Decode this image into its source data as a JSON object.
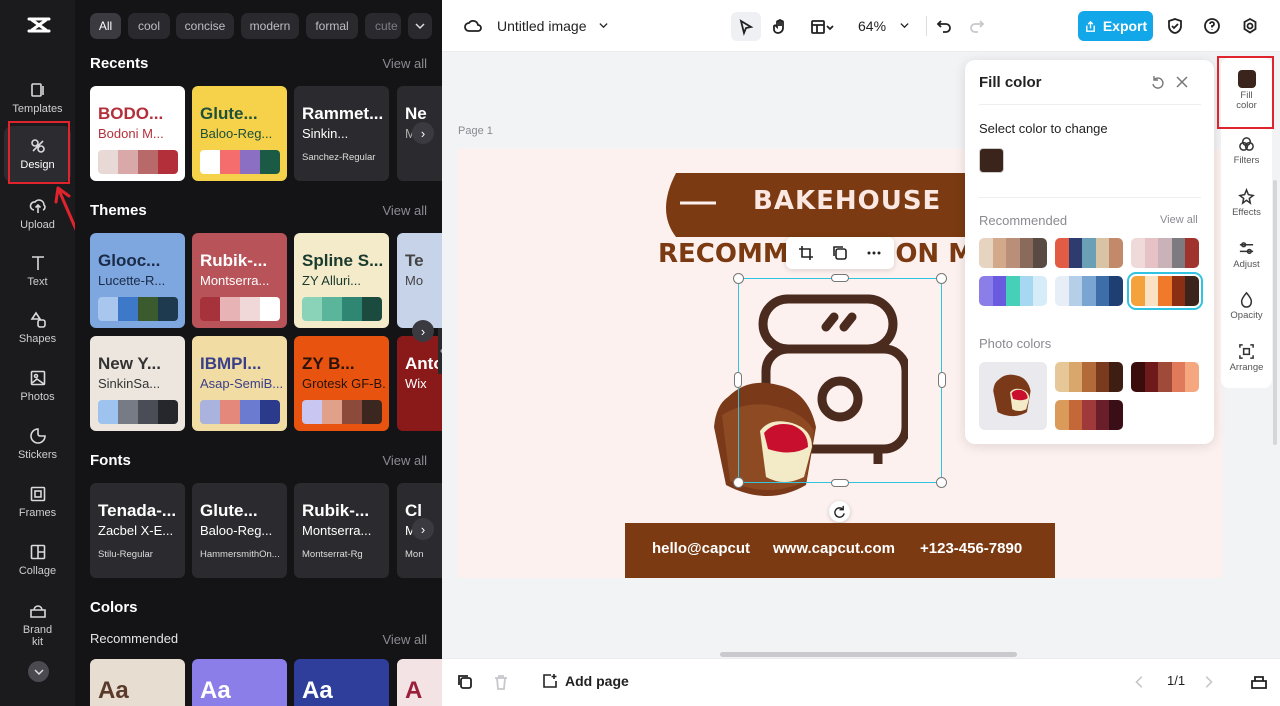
{
  "nav": {
    "items": [
      {
        "label": "Templates",
        "icon": "templates-icon"
      },
      {
        "label": "Design",
        "icon": "design-icon"
      },
      {
        "label": "Upload",
        "icon": "upload-icon"
      },
      {
        "label": "Text",
        "icon": "text-icon"
      },
      {
        "label": "Shapes",
        "icon": "shapes-icon"
      },
      {
        "label": "Photos",
        "icon": "photos-icon"
      },
      {
        "label": "Stickers",
        "icon": "stickers-icon"
      },
      {
        "label": "Frames",
        "icon": "frames-icon"
      },
      {
        "label": "Collage",
        "icon": "collage-icon"
      },
      {
        "label": "Brand kit",
        "icon": "brand-kit-icon"
      }
    ]
  },
  "filters": {
    "chips": [
      "All",
      "cool",
      "concise",
      "modern",
      "formal",
      "cute"
    ]
  },
  "panel": {
    "view_all": "View all",
    "recents": {
      "title": "Recents",
      "cards": [
        {
          "t1": "BODO...",
          "t2": "Bodoni M...",
          "bg": "#ffffff",
          "c1": "#b3303a",
          "c2": "#b3303a",
          "swatches": [
            "#e8d9d6",
            "#d9a8a8",
            "#b86a6a",
            "#b3303a"
          ]
        },
        {
          "t1": "Glute...",
          "t2": "Baloo-Reg...",
          "bg": "#f5d24a",
          "c1": "#1f4f3a",
          "c2": "#1f4f3a",
          "swatches": [
            "#ffffff",
            "#f56d6d",
            "#8b6fc2",
            "#1b5a45"
          ]
        },
        {
          "t1": "Rammet...",
          "t2": "Sinkin...",
          "t3": "Sanchez-Regular",
          "bg": "#2b2b2f",
          "c1": "#ffffff",
          "c2": "#ffffff"
        },
        {
          "t1": "Ne",
          "t2": "Mon",
          "bg": "#2b2b2f",
          "c1": "#ffffff",
          "c2": "#aaaaaa"
        }
      ]
    },
    "themes": {
      "title": "Themes",
      "cards": [
        {
          "t1": "Glooc...",
          "t2": "Lucette-R...",
          "bg": "#7ea6df",
          "c1": "#1a2b48",
          "c2": "#1a2b48",
          "swatches": [
            "#a9c6ee",
            "#3d78c9",
            "#3b5a2e",
            "#1e3a4e"
          ]
        },
        {
          "t1": "Rubik-...",
          "t2": "Montserra...",
          "bg": "#b8535a",
          "c1": "#ffffff",
          "c2": "#ffffff",
          "swatches": [
            "#a6323b",
            "#e8b3b5",
            "#f0d7d8",
            "#ffffff"
          ]
        },
        {
          "t1": "Spline S...",
          "t2": "ZY Alluri...",
          "bg": "#f3ebc9",
          "c1": "#1b3a2e",
          "c2": "#1b3a2e",
          "swatches": [
            "#8bd3b8",
            "#5ab59a",
            "#2f8672",
            "#1b4a3e"
          ]
        },
        {
          "t1": "Te",
          "t2": "Mo",
          "bg": "#c6d3e8",
          "c1": "#444444",
          "c2": "#444444"
        },
        {
          "t1": "New Y...",
          "t2": "SinkinSa...",
          "bg": "#ece6df",
          "c1": "#333333",
          "c2": "#333333",
          "swatches": [
            "#9ec3ee",
            "#777b85",
            "#4a4d55",
            "#25272c"
          ]
        },
        {
          "t1": "IBMPl...",
          "t2": "Asap-SemiB...",
          "bg": "#f1dca3",
          "c1": "#3a3f8a",
          "c2": "#3a3f8a",
          "swatches": [
            "#a9b3dd",
            "#e3887a",
            "#6b7bd0",
            "#2b3a8a"
          ]
        },
        {
          "t1": "ZY B...",
          "t2": "Grotesk GF-B...",
          "bg": "#e8540f",
          "c1": "#2a1208",
          "c2": "#2a1208",
          "swatches": [
            "#c9c7f2",
            "#e1a08a",
            "#8b4a3a",
            "#3c2620"
          ]
        },
        {
          "t1": "Anto",
          "t2": "Wix",
          "bg": "#8a1a1a",
          "c1": "#ffffff",
          "c2": "#ffffff"
        }
      ]
    },
    "fonts": {
      "title": "Fonts",
      "cards": [
        {
          "t1": "Tenada-...",
          "t2": "Zacbel X-E...",
          "t3": "Stilu-Regular"
        },
        {
          "t1": "Glute...",
          "t2": "Baloo-Reg...",
          "t3": "HammersmithOn..."
        },
        {
          "t1": "Rubik-...",
          "t2": "Montserra...",
          "t3": "Montserrat-Rg"
        },
        {
          "t1": "Cl",
          "t2": "M",
          "t3": "Mon"
        }
      ]
    },
    "colors": {
      "title": "Colors",
      "subtitle": "Recommended",
      "cards": [
        {
          "label": "Aa",
          "bg": "#e8ddd1",
          "color": "#5a3b2b"
        },
        {
          "label": "Aa",
          "bg": "#8c7ee8",
          "color": "#ffffff"
        },
        {
          "label": "Aa",
          "bg": "#2e3e9a",
          "color": "#ffffff"
        },
        {
          "label": "A",
          "bg": "#f3e3e5",
          "color": "#9a1f3a"
        }
      ]
    }
  },
  "topbar": {
    "doc_title": "Untitled image",
    "zoom": "64%",
    "export_label": "Export"
  },
  "canvas": {
    "page_label": "Page 1",
    "brand": "BAKEHOUSE",
    "headline": "RECOMMENDATION MENU",
    "footer_email": "hello@capcut",
    "footer_site": "www.capcut.com",
    "footer_phone": "+123-456-7890"
  },
  "fill_panel": {
    "title": "Fill color",
    "select_label": "Select color to change",
    "current_color": "#3a241b",
    "recommended_label": "Recommended",
    "view_all": "View all",
    "palettes": [
      [
        "#e6d3c0",
        "#d2a98a",
        "#b98f7a",
        "#8a6a5a",
        "#5a4a44"
      ],
      [
        "#e25b45",
        "#2e3b6e",
        "#6aa0b5",
        "#d9c3a5",
        "#c28a6a"
      ],
      [
        "#efd9d9",
        "#e6c2c6",
        "#c9b3b8",
        "#7d7a80",
        "#a0332e"
      ],
      [
        "#8c7ee8",
        "#6a5ae0",
        "#46d0b8",
        "#a6d8f2",
        "#d6ecf8"
      ],
      [
        "#e8eef6",
        "#b6cfe8",
        "#7aa5d2",
        "#3e6ea8",
        "#1f3f72"
      ],
      [
        "#f5a23d",
        "#fbe2c4",
        "#ef7a2a",
        "#8a2e14",
        "#3a241b"
      ]
    ],
    "photo_label": "Photo colors",
    "photo_palettes": [
      [
        "#e6c798",
        "#d9a66b",
        "#b36a3a",
        "#7a3a1e",
        "#3e1e12"
      ],
      [
        "#3a0c0c",
        "#6e1a1a",
        "#a04a3a",
        "#e07a5a",
        "#f5a880"
      ],
      [
        "#d99a5a",
        "#c4683a",
        "#a03a3a",
        "#6a1e2a",
        "#3a0e16"
      ]
    ]
  },
  "right_tools": {
    "items": [
      "Fill color",
      "Filters",
      "Effects",
      "Adjust",
      "Opacity",
      "Arrange"
    ]
  },
  "bottombar": {
    "add_page": "Add page",
    "page_count": "1/1"
  }
}
